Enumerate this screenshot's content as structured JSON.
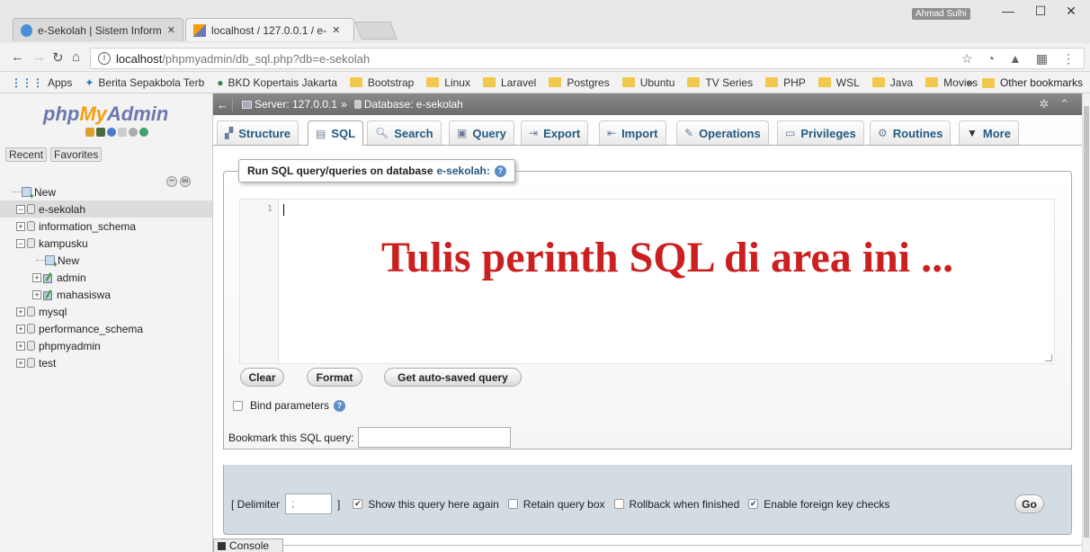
{
  "browser": {
    "tabs": [
      {
        "title": "e-Sekolah | Sistem Inform",
        "close": "✕"
      },
      {
        "title": "localhost / 127.0.0.1 / e-",
        "close": "✕"
      }
    ],
    "profile": "Ahmad Sulhi",
    "window_controls": {
      "minimize": "—",
      "maximize": "☐",
      "close": "✕"
    },
    "url_host": "localhost",
    "url_path": "/phpmyadmin/db_sql.php?db=e-sekolah",
    "bookmarks": [
      "Apps",
      "Berita Sepakbola Terb",
      "BKD Kopertais Jakarta",
      "Bootstrap",
      "Linux",
      "Laravel",
      "Postgres",
      "Ubuntu",
      "TV Series",
      "PHP",
      "WSL",
      "Java",
      "Movies"
    ],
    "bookmarks_overflow": "»",
    "other_bookmarks": "Other bookmarks"
  },
  "sidebar": {
    "logo": {
      "php": "php",
      "my": "My",
      "admin": "Admin"
    },
    "recent": "Recent",
    "favorites": "Favorites",
    "tree": [
      {
        "label": "New",
        "type": "new",
        "level": 0
      },
      {
        "label": "e-sekolah",
        "type": "db",
        "level": 0,
        "expander": "−",
        "selected": true
      },
      {
        "label": "information_schema",
        "type": "db",
        "level": 0,
        "expander": "+"
      },
      {
        "label": "kampusku",
        "type": "db",
        "level": 0,
        "expander": "−"
      },
      {
        "label": "New",
        "type": "new",
        "level": 1
      },
      {
        "label": "admin",
        "type": "table",
        "level": 1,
        "expander": "+"
      },
      {
        "label": "mahasiswa",
        "type": "table",
        "level": 1,
        "expander": "+"
      },
      {
        "label": "mysql",
        "type": "db",
        "level": 0,
        "expander": "+"
      },
      {
        "label": "performance_schema",
        "type": "db",
        "level": 0,
        "expander": "+"
      },
      {
        "label": "phpmyadmin",
        "type": "db",
        "level": 0,
        "expander": "+"
      },
      {
        "label": "test",
        "type": "db",
        "level": 0,
        "expander": "+"
      }
    ]
  },
  "serverbar": {
    "server": "Server: 127.0.0.1",
    "separator": "»",
    "database": "Database: e-sekolah"
  },
  "tabs": [
    "Structure",
    "SQL",
    "Search",
    "Query",
    "Export",
    "Import",
    "Operations",
    "Privileges",
    "Routines",
    "More"
  ],
  "sql_panel": {
    "legend_prefix": "Run SQL query/queries on database",
    "db_name": "e-sekolah:",
    "line_number": "1",
    "annotation": "Tulis perinth SQL di area ini ...",
    "buttons": {
      "clear": "Clear",
      "format": "Format",
      "autosaved": "Get auto-saved query"
    },
    "bind_parameters": "Bind parameters",
    "bookmark_label": "Bookmark this SQL query:",
    "bookmark_value": ""
  },
  "footer": {
    "delimiter_label": "[ Delimiter",
    "delimiter_value": ";",
    "delimiter_close": "]",
    "options": [
      {
        "label": "Show this query here again",
        "checked": true
      },
      {
        "label": "Retain query box",
        "checked": false
      },
      {
        "label": "Rollback when finished",
        "checked": false
      },
      {
        "label": "Enable foreign key checks",
        "checked": true
      }
    ],
    "go": "Go"
  },
  "console": "Console"
}
